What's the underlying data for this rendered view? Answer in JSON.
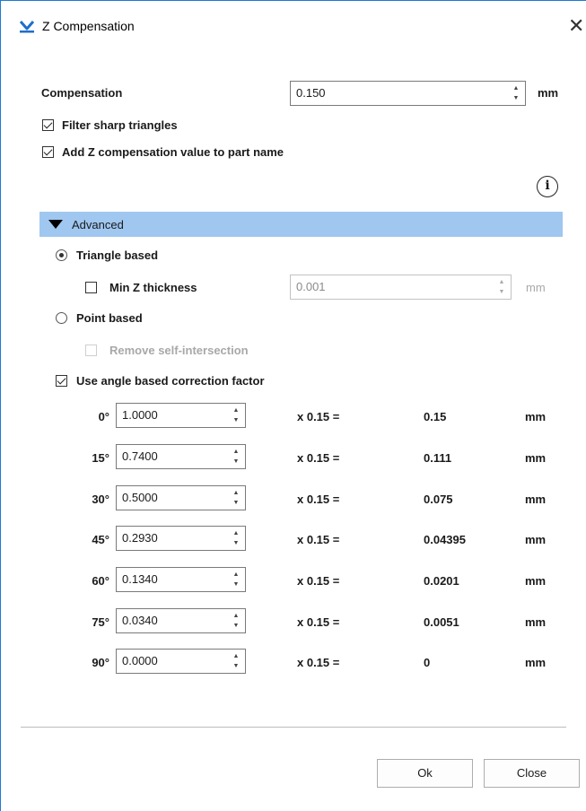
{
  "window": {
    "title": "Z Compensation",
    "close_glyph": "✕",
    "app_icon": "materialise-logo-icon"
  },
  "compensation": {
    "label": "Compensation",
    "value": "0.150",
    "unit": "mm"
  },
  "options": {
    "filter_sharp_label": "Filter sharp triangles",
    "filter_sharp_checked": true,
    "add_value_label": "Add Z compensation value to part name",
    "add_value_checked": true,
    "info_icon": "info-icon",
    "info_glyph": "i"
  },
  "advanced": {
    "label": "Advanced",
    "expanded": true,
    "triangle_based_label": "Triangle based",
    "triangle_based_selected": true,
    "min_z_label": "Min Z thickness",
    "min_z_checked": false,
    "min_z_value": "0.001",
    "min_z_unit": "mm",
    "point_based_label": "Point based",
    "point_based_selected": false,
    "remove_self_label": "Remove self-intersection",
    "remove_self_checked": false,
    "remove_self_enabled": false,
    "angle_label": "Use angle based correction factor",
    "angle_checked": true
  },
  "angles": [
    {
      "angle": "0°",
      "factor": "1.0000",
      "mult": "x 0.15 =",
      "result": "0.15",
      "unit": "mm"
    },
    {
      "angle": "15°",
      "factor": "0.7400",
      "mult": "x 0.15 =",
      "result": "0.111",
      "unit": "mm"
    },
    {
      "angle": "30°",
      "factor": "0.5000",
      "mult": "x 0.15 =",
      "result": "0.075",
      "unit": "mm"
    },
    {
      "angle": "45°",
      "factor": "0.2930",
      "mult": "x 0.15 =",
      "result": "0.04395",
      "unit": "mm"
    },
    {
      "angle": "60°",
      "factor": "0.1340",
      "mult": "x 0.15 =",
      "result": "0.0201",
      "unit": "mm"
    },
    {
      "angle": "75°",
      "factor": "0.0340",
      "mult": "x 0.15 =",
      "result": "0.0051",
      "unit": "mm"
    },
    {
      "angle": "90°",
      "factor": "0.0000",
      "mult": "x 0.15 =",
      "result": "0",
      "unit": "mm"
    }
  ],
  "buttons": {
    "ok": "Ok",
    "close": "Close"
  },
  "colors": {
    "section_bar": "#9fc7f0",
    "window_border": "#1f7ad4",
    "logo": "#1f6fc9"
  }
}
